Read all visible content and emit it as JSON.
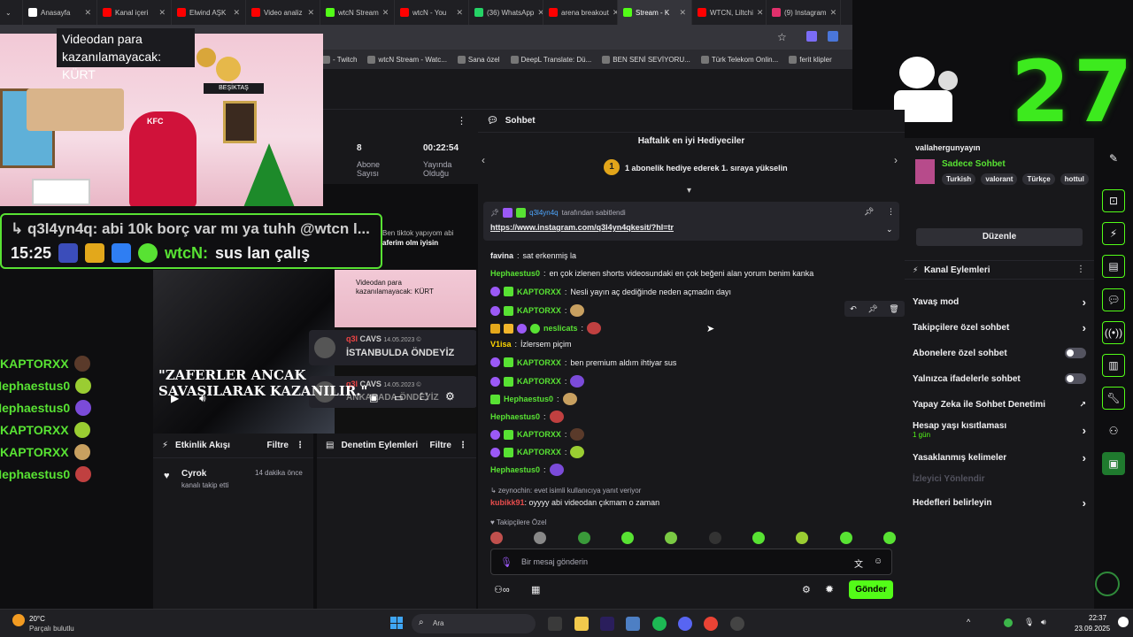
{
  "browser": {
    "tabs": [
      {
        "label": "Anasayfa",
        "color": "#ffffff"
      },
      {
        "label": "Kanal içeri",
        "color": "#ff0000"
      },
      {
        "label": "Elwind AŞK",
        "color": "#ff0000"
      },
      {
        "label": "Video analiz",
        "color": "#ff0000"
      },
      {
        "label": "wtcN Stream",
        "color": "#53fc18"
      },
      {
        "label": "wtcN - You",
        "color": "#ff0000"
      },
      {
        "label": "(36) WhatsApp",
        "color": "#25d366"
      },
      {
        "label": "arena breakout",
        "color": "#ff0000"
      },
      {
        "label": "Stream - K",
        "color": "#53fc18",
        "active": true
      },
      {
        "label": "WTCN, Liltchi",
        "color": "#ff0000"
      },
      {
        "label": "(9) Instagram",
        "color": "#e1306c"
      }
    ],
    "bookmarks": [
      "- Twitch",
      "wtcN Stream - Watc...",
      "Sana özel",
      "DeepL Translate: Dü...",
      "BEN SENİ SEVİYORU...",
      "Türk Telekom Onlin...",
      "ferit klipler"
    ]
  },
  "overlay": {
    "caption": "Videodan para kazanılamayacak: KÜRT",
    "banner_text": "BEŞİKTAŞ",
    "kfc": "KFC",
    "chat_line1": "↳ q3l4yn4q: abi 10k borç var mı ya tuhh @wtcn l...",
    "chat_time": "15:25",
    "chat_user": "wtcN:",
    "chat_msg": "sus lan çalış",
    "viewer_count": "27",
    "left_names": [
      "KAPTORXX",
      "Hephaestus0",
      "Hephaestus0",
      "KAPTORXX",
      "KAPTORXX",
      "Hephaestus0"
    ],
    "mini_chat": [
      "Ben tiktok yapıyom abi",
      "aferim olm iyisin",
      "Videodan para",
      "kazanılamayacak: KÜRT"
    ],
    "quote_line1": "\"ZAFERLER ANCAK",
    "quote_line2": "SAVAŞILARAK KAZANILIR.\"",
    "side_chat": [
      {
        "user": "q3l",
        "tag": "CAVS",
        "date": "14.05.2023 ©",
        "msg": "İSTANBULDA ÖNDEYİZ"
      },
      {
        "user": "q3l",
        "tag": "CAVS",
        "date": "14.05.2023 ©",
        "msg": "ANKARADA ÖNDEYİZ"
      }
    ]
  },
  "stats": [
    {
      "value": "8",
      "label": "Abone Sayısı"
    },
    {
      "value": "00:22:54",
      "label": "Yayında Olduğu"
    }
  ],
  "activity": {
    "title": "Etkinlik Akışı",
    "filter": "Filtre",
    "item_user": "Cyrok",
    "item_text": "kanalı takip etti",
    "item_time": "14 dakika önce"
  },
  "moderation": {
    "title": "Denetim Eylemleri",
    "filter": "Filtre"
  },
  "chat": {
    "title": "Sohbet",
    "gifters_title": "Haftalık en iyi Hediyeciler",
    "gifters_rank": "1",
    "gifters_text": "1 abonelik hediye ederek 1. sıraya yükselin",
    "pinned_by": "q3l4yn4q",
    "pinned_suffix": "tarafından sabitlendi",
    "pinned_link": "https://www.instagram.com/q3l4yn4qkesit/?hl=tr",
    "messages": [
      {
        "user": "favina",
        "color": "#efeff1",
        "text": "sat erkenmiş la"
      },
      {
        "user": "Hephaestus0",
        "color": "#58e233",
        "text": "en çok izlenen shorts videosundaki en çok beğeni alan yorum benim kanka"
      },
      {
        "user": "KAPTORXX",
        "color": "#58e233",
        "text": "Nesli yayın aç dediğinde neden açmadın dayı"
      },
      {
        "user": "KAPTORXX",
        "color": "#58e233",
        "text": ""
      },
      {
        "user": "neslicats",
        "color": "#58e233",
        "text": ""
      },
      {
        "user": "V1isa",
        "color": "#ffd700",
        "text": "İzlersem piçim"
      },
      {
        "user": "KAPTORXX",
        "color": "#58e233",
        "text": "ben premium aldım ihtiyar sus"
      },
      {
        "user": "KAPTORXX",
        "color": "#58e233",
        "text": ""
      },
      {
        "user": "Hephaestus0",
        "color": "#58e233",
        "text": ""
      },
      {
        "user": "Hephaestus0",
        "color": "#58e233",
        "text": ""
      },
      {
        "user": "KAPTORXX",
        "color": "#58e233",
        "text": ""
      },
      {
        "user": "KAPTORXX",
        "color": "#58e233",
        "text": ""
      },
      {
        "user": "Hephaestus0",
        "color": "#58e233",
        "text": ""
      }
    ],
    "reply_to": "↳ zeynochin: evet isimli kullanıcıya yanıt veriyor",
    "last_user": "kubikk91",
    "last_text": "oyyyy abi videodan çıkmam o zaman",
    "followers_label": "♥ Takipçilere Özel",
    "input_placeholder": "Bir mesaj gönderin",
    "send_label": "Gönder"
  },
  "channel": {
    "owner": "vallahergunyayın",
    "chat_mode": "Sadece Sohbet",
    "tags": [
      "Turkish",
      "valorant",
      "Türkçe",
      "hottul"
    ],
    "edit_label": "Düzenle",
    "actions_title": "Kanal Eylemleri",
    "options": [
      {
        "label": "Yavaş mod",
        "kind": "chevron"
      },
      {
        "label": "Takipçilere özel sohbet",
        "kind": "chevron"
      },
      {
        "label": "Abonelere özel sohbet",
        "kind": "toggle"
      },
      {
        "label": "Yalnızca ifadelerle sohbet",
        "kind": "toggle"
      },
      {
        "label": "Yapay Zeka ile Sohbet Denetimi",
        "kind": "external"
      },
      {
        "label": "Hesap yaşı kısıtlaması",
        "kind": "chevron",
        "sub": "1 gün"
      },
      {
        "label": "Yasaklanmış kelimeler",
        "kind": "chevron"
      },
      {
        "label": "İzleyici Yönlendir",
        "kind": "disabled"
      },
      {
        "label": "Hedefleri belirleyin",
        "kind": "chevron"
      }
    ]
  },
  "taskbar": {
    "temp": "20°C",
    "weather": "Parçalı bulutlu",
    "search": "Ara",
    "time": "22:37",
    "date": "23.09.2025"
  }
}
